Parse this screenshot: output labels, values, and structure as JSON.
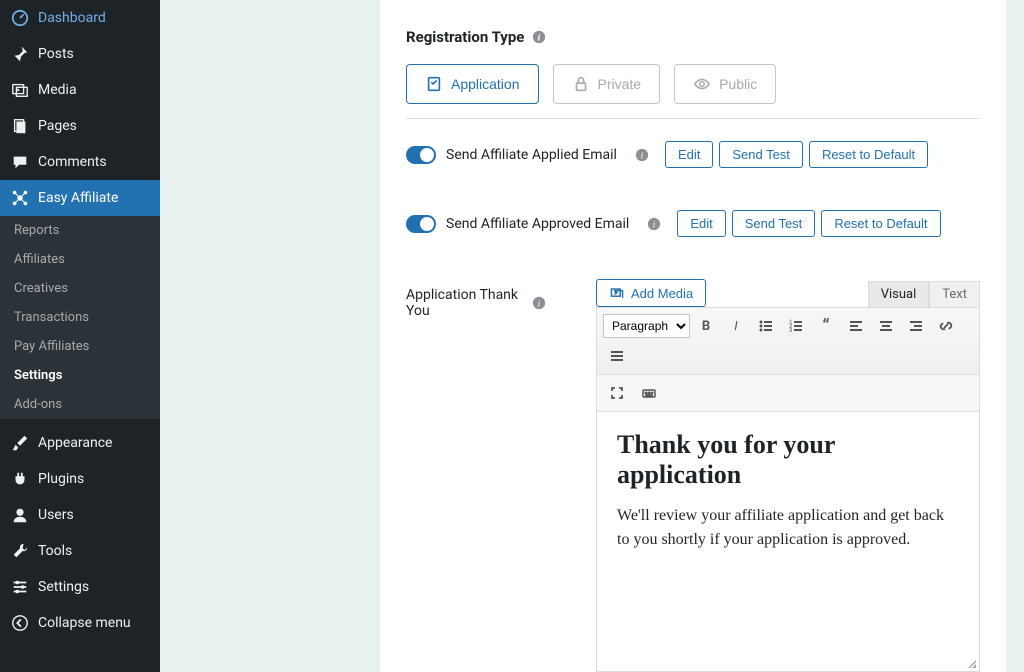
{
  "sidebar": {
    "items": [
      {
        "label": "Dashboard",
        "icon": "dashboard"
      },
      {
        "label": "Posts",
        "icon": "pin"
      },
      {
        "label": "Media",
        "icon": "media"
      },
      {
        "label": "Pages",
        "icon": "pages"
      },
      {
        "label": "Comments",
        "icon": "comments"
      },
      {
        "label": "Easy Affiliate",
        "icon": "affiliate",
        "active": true
      },
      {
        "label": "Appearance",
        "icon": "brush"
      },
      {
        "label": "Plugins",
        "icon": "plug"
      },
      {
        "label": "Users",
        "icon": "user"
      },
      {
        "label": "Tools",
        "icon": "wrench"
      },
      {
        "label": "Settings",
        "icon": "sliders"
      },
      {
        "label": "Collapse menu",
        "icon": "collapse"
      }
    ],
    "subitems": [
      {
        "label": "Reports"
      },
      {
        "label": "Affiliates"
      },
      {
        "label": "Creatives"
      },
      {
        "label": "Transactions"
      },
      {
        "label": "Pay Affiliates"
      },
      {
        "label": "Settings",
        "current": true
      },
      {
        "label": "Add-ons"
      }
    ]
  },
  "section": {
    "title": "Registration Type"
  },
  "reg_types": [
    {
      "label": "Application",
      "icon": "application",
      "active": true
    },
    {
      "label": "Private",
      "icon": "lock"
    },
    {
      "label": "Public",
      "icon": "eye"
    }
  ],
  "email_rows": [
    {
      "label": "Send Affiliate Applied Email",
      "buttons": [
        "Edit",
        "Send Test",
        "Reset to Default"
      ]
    },
    {
      "label": "Send Affiliate Approved Email",
      "buttons": [
        "Edit",
        "Send Test",
        "Reset to Default"
      ]
    }
  ],
  "thank_you": {
    "label": "Application Thank You",
    "add_media": "Add Media",
    "tabs": {
      "visual": "Visual",
      "text": "Text"
    },
    "paragraph_select": "Paragraph",
    "heading": "Thank you for your application",
    "body": "We'll review your affiliate application and get back to you shortly if your application is approved."
  }
}
